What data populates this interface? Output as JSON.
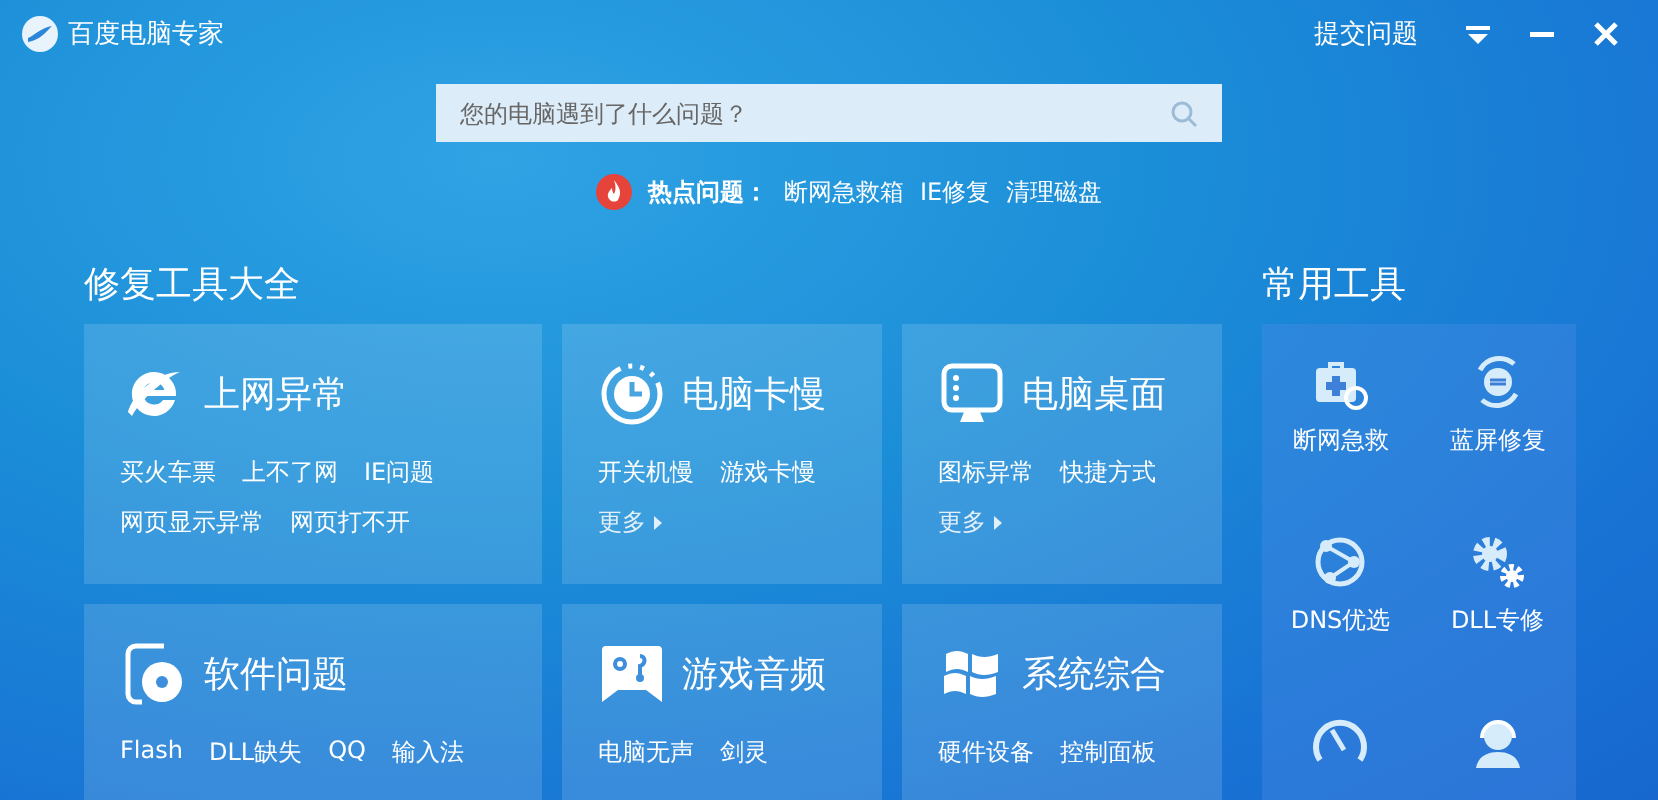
{
  "window": {
    "title": "百度电脑专家",
    "actions": [
      {
        "kind": "text",
        "label": "提交问题"
      },
      {
        "kind": "dropdown"
      },
      {
        "kind": "minimize"
      },
      {
        "kind": "close"
      }
    ]
  },
  "search": {
    "placeholder": "您的电脑遇到了什么问题？"
  },
  "hot_issues": {
    "label": "热点问题：",
    "links": [
      "断网急救箱",
      "IE修复",
      "清理磁盘"
    ]
  },
  "repair_tools": {
    "title": "修复工具大全",
    "cards": [
      {
        "kind": "ie",
        "title": "上网异常",
        "links": [
          "买火车票",
          "上不了网",
          "IE问题",
          "网页显示异常",
          "网页打不开"
        ]
      },
      {
        "kind": "clock",
        "title": "电脑卡慢",
        "links": [
          "开关机慢",
          "游戏卡慢"
        ],
        "more": "更多"
      },
      {
        "kind": "monitor",
        "title": "电脑桌面",
        "links": [
          "图标异常",
          "快捷方式"
        ],
        "more": "更多"
      },
      {
        "kind": "disc",
        "title": "软件问题",
        "links": [
          "Flash",
          "DLL缺失",
          "QQ",
          "输入法"
        ]
      },
      {
        "kind": "gamepad",
        "title": "游戏音频",
        "links": [
          "电脑无声",
          "剑灵"
        ]
      },
      {
        "kind": "windows",
        "title": "系统综合",
        "links": [
          "硬件设备",
          "控制面板"
        ]
      }
    ]
  },
  "common_tools": {
    "title": "常用工具",
    "tools": [
      {
        "kind": "firstaid",
        "label": "断网急救"
      },
      {
        "kind": "bluescreen",
        "label": "蓝屏修复"
      },
      {
        "kind": "dns",
        "label": "DNS优选"
      },
      {
        "kind": "dll",
        "label": "DLL专修"
      },
      {
        "kind": "speed"
      },
      {
        "kind": "support"
      }
    ]
  }
}
